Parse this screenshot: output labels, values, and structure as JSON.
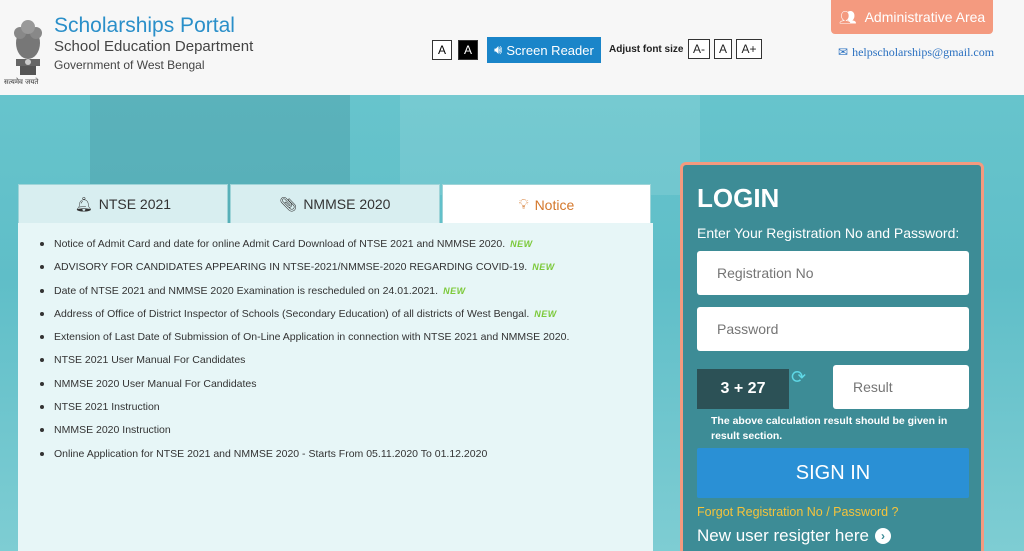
{
  "header": {
    "emblem_motto": "सत्यमेव जयते",
    "title": "Scholarships Portal",
    "department": "School Education Department",
    "government": "Government of West Bengal",
    "contrast_normal": "A",
    "contrast_high": "A",
    "screen_reader_label": "Screen Reader",
    "adjust_font_label": "Adjust font size",
    "font_decrease": "A-",
    "font_normal": "A",
    "font_increase": "A+",
    "admin_label": "Administrative Area",
    "help_email": "helpscholarships@gmail.com"
  },
  "tabs": [
    {
      "label": "NTSE 2021",
      "icon": "bell-icon"
    },
    {
      "label": "NMMSE 2020",
      "icon": "paperclip-icon"
    },
    {
      "label": "Notice",
      "icon": "lightbulb-icon",
      "active": true
    }
  ],
  "notices": [
    {
      "text": "Notice of Admit Card and date for online Admit Card Download of NTSE 2021 and NMMSE 2020.",
      "new": "NEW"
    },
    {
      "text": "ADVISORY FOR CANDIDATES APPEARING IN NTSE-2021/NMMSE-2020 REGARDING COVID-19.",
      "new": "NEW"
    },
    {
      "text": "Date of NTSE 2021 and NMMSE 2020 Examination is rescheduled on 24.01.2021.",
      "new": "NEW"
    },
    {
      "text": "Address of Office of District Inspector of Schools (Secondary Education) of all districts of West Bengal.",
      "new": "NEW"
    },
    {
      "text": "Extension of Last Date of Submission of On-Line Application in connection with NTSE 2021 and NMMSE 2020."
    },
    {
      "text": "NTSE 2021 User Manual For Candidates"
    },
    {
      "text": "NMMSE 2020 User Manual For Candidates"
    },
    {
      "text": "NTSE 2021 Instruction"
    },
    {
      "text": "NMMSE 2020 Instruction"
    },
    {
      "text": "Online Application for NTSE 2021 and NMMSE 2020 - Starts From 05.11.2020 To 01.12.2020"
    }
  ],
  "login": {
    "title": "LOGIN",
    "subtitle": "Enter Your Registration No and Password:",
    "registration_placeholder": "Registration No",
    "password_placeholder": "Password",
    "captcha": "3 + 27",
    "result_placeholder": "Result",
    "captcha_note": "The above calculation result should be given in result section.",
    "signin_label": "SIGN IN",
    "forgot_label": "Forgot Registration No / Password ?",
    "new_user_label": "New user resigter here"
  },
  "colors": {
    "brand_blue": "#2a8fc9",
    "admin_orange": "#f49a7f",
    "login_teal": "#3d8c96",
    "signin_blue": "#2a90d5",
    "forgot_yellow": "#f5c33b",
    "notice_tab_orange": "#d4782c"
  }
}
